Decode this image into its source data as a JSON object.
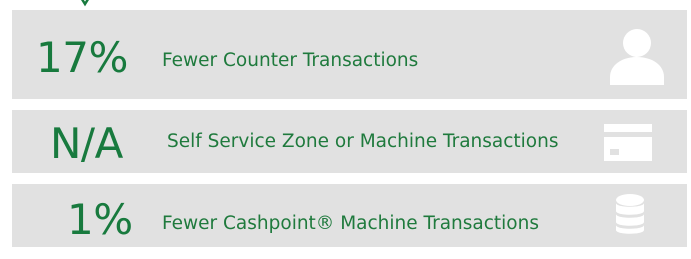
{
  "stats": [
    {
      "value": "17%",
      "label": "Fewer Counter Transactions",
      "icon": "person-icon"
    },
    {
      "value": "N/A",
      "label": "Self Service Zone or Machine Transactions",
      "icon": "card-icon"
    },
    {
      "value": "1%",
      "label": "Fewer Cashpoint® Machine Transactions",
      "icon": "coin-stack-icon"
    }
  ],
  "colors": {
    "accent_green": "#187a3e",
    "row_background": "#e1e1e1",
    "icon_white": "#ffffff"
  }
}
